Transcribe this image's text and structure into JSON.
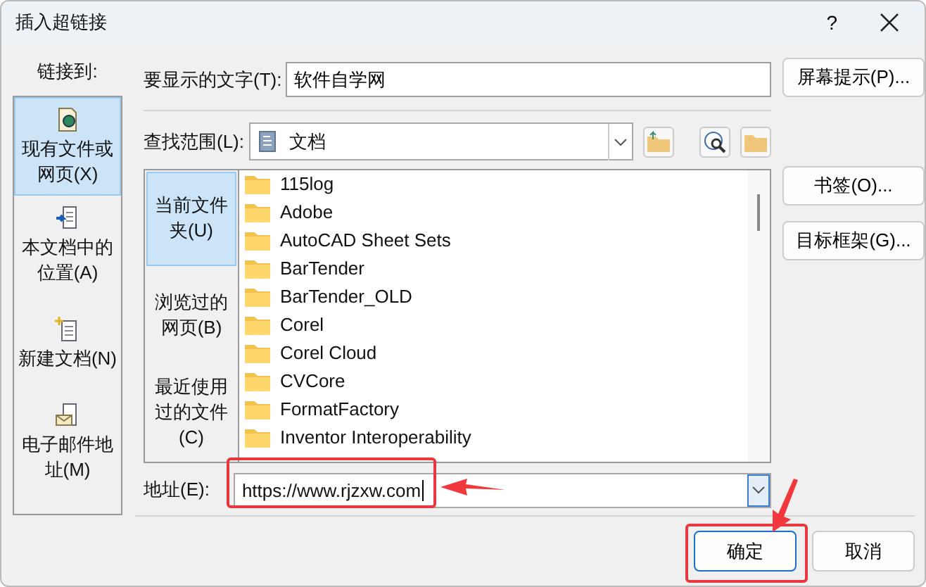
{
  "window": {
    "title": "插入超链接",
    "help": "?"
  },
  "link_to": {
    "label": "链接到:",
    "items": [
      {
        "label": "现有文件或网页(X)",
        "kind": "file-web",
        "selected": true
      },
      {
        "label": "本文档中的位置(A)",
        "kind": "place",
        "selected": false
      },
      {
        "label": "新建文档(N)",
        "kind": "new-doc",
        "selected": false
      },
      {
        "label": "电子邮件地址(M)",
        "kind": "email",
        "selected": false
      }
    ]
  },
  "display_text": {
    "label": "要显示的文字(T):",
    "value": "软件自学网"
  },
  "screentip_button": "屏幕提示(P)...",
  "look_in": {
    "label": "查找范围(L):",
    "value": "文档"
  },
  "nav": [
    {
      "label": "当前文件夹(U)",
      "selected": true
    },
    {
      "label": "浏览过的网页(B)",
      "selected": false
    },
    {
      "label": "最近使用过的文件(C)",
      "selected": false
    }
  ],
  "files": [
    "115log",
    "Adobe",
    "AutoCAD Sheet Sets",
    "BarTender",
    "BarTender_OLD",
    "Corel",
    "Corel Cloud",
    "CVCore",
    "FormatFactory",
    "Inventor Interoperability"
  ],
  "side_buttons": [
    "书签(O)...",
    "目标框架(G)..."
  ],
  "address": {
    "label": "地址(E):",
    "value": "https://www.rjzxw.com"
  },
  "buttons": [
    {
      "label": "确定",
      "default": true
    },
    {
      "label": "取消",
      "default": false
    }
  ]
}
